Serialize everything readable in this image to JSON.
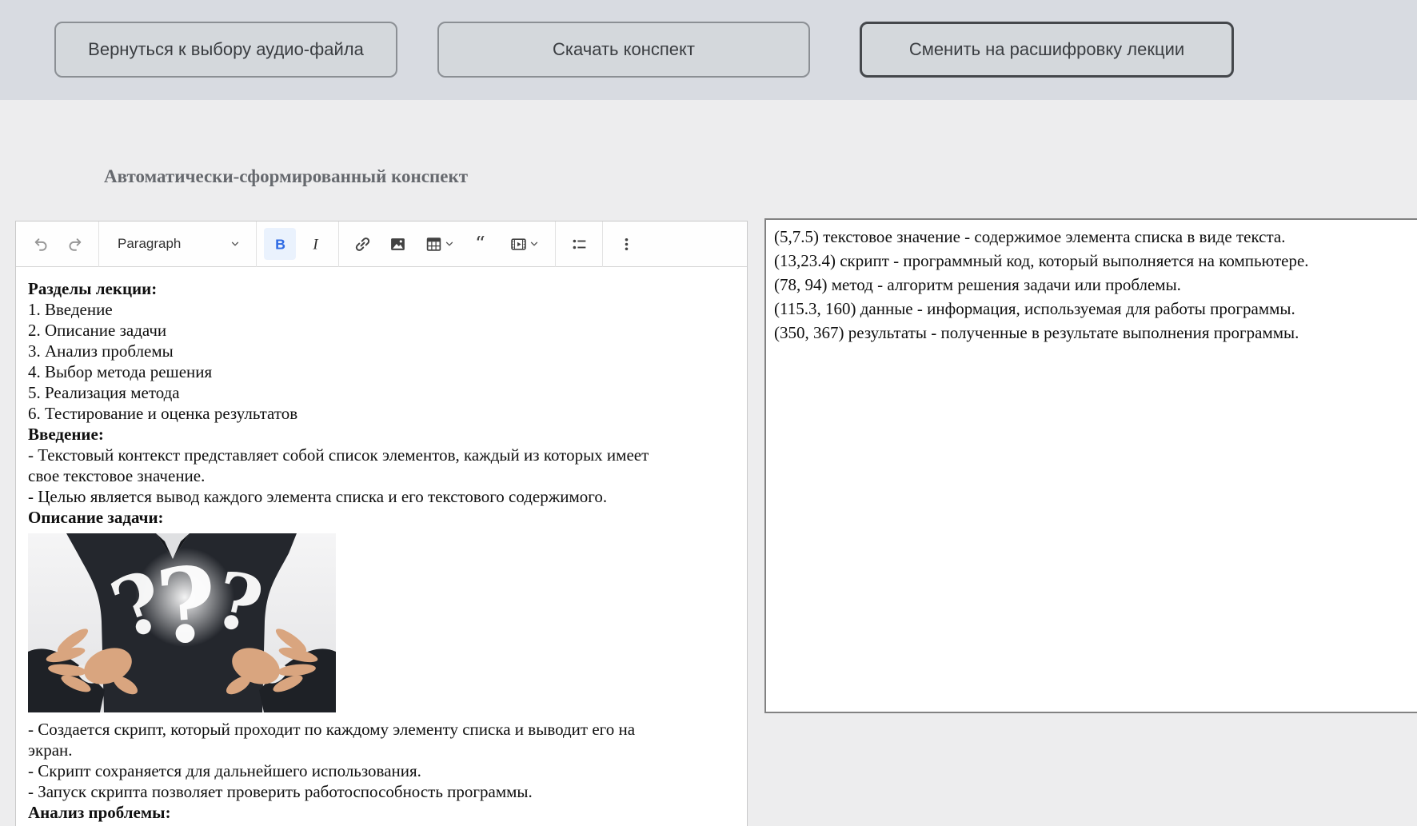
{
  "colors": {
    "topbar_bg": "#d8dbe1",
    "page_bg": "#ededee",
    "button_bg": "#d4d8dc",
    "button_border": "#8b8f94",
    "button_border_emphasized": "#44474b",
    "heading_color": "#66696e",
    "bold_active_bg": "#eaf2fd",
    "bold_icon_blue": "#2f6be4",
    "toolbar_icon_color": "#424242",
    "toolbar_disabled_icon_color": "#969696"
  },
  "topbar": {
    "buttons": [
      {
        "label": "Вернуться к выбору аудио-файла"
      },
      {
        "label": "Скачать конспект"
      },
      {
        "label": "Сменить на расшифровку лекции",
        "emphasized": true
      }
    ]
  },
  "heading": {
    "title": "Автоматически-сформированный конспект"
  },
  "editor": {
    "toolbar": {
      "paragraph_label": "Paragraph",
      "items": [
        {
          "type": "button",
          "name": "undo",
          "disabled": true
        },
        {
          "type": "button",
          "name": "redo",
          "disabled": true
        },
        {
          "type": "separator"
        },
        {
          "type": "dropdown",
          "name": "paragraph-style-dropdown",
          "label": "Paragraph"
        },
        {
          "type": "separator"
        },
        {
          "type": "button",
          "name": "bold",
          "active": true
        },
        {
          "type": "button",
          "name": "italic"
        },
        {
          "type": "separator"
        },
        {
          "type": "button",
          "name": "link"
        },
        {
          "type": "button",
          "name": "insert-image"
        },
        {
          "type": "button",
          "name": "insert-table",
          "chevron": true
        },
        {
          "type": "button",
          "name": "block-quote"
        },
        {
          "type": "button",
          "name": "insert-media",
          "chevron": true
        },
        {
          "type": "separator"
        },
        {
          "type": "button",
          "name": "bulleted-list"
        },
        {
          "type": "separator"
        },
        {
          "type": "button",
          "name": "more-options"
        }
      ]
    },
    "content": {
      "blocks": [
        {
          "bold": true,
          "text": "Разделы лекции:"
        },
        {
          "bold": false,
          "text": "1. Введение"
        },
        {
          "bold": false,
          "text": "2. Описание задачи"
        },
        {
          "bold": false,
          "text": "3. Анализ проблемы"
        },
        {
          "bold": false,
          "text": "4. Выбор метода решения"
        },
        {
          "bold": false,
          "text": "5. Реализация метода"
        },
        {
          "bold": false,
          "text": "6. Тестирование и оценка результатов"
        },
        {
          "bold": true,
          "text": "Введение:"
        },
        {
          "bold": false,
          "text": "- Текстовый контекст представляет собой список элементов, каждый из которых имеет"
        },
        {
          "bold": false,
          "text": "свое текстовое значение."
        },
        {
          "bold": false,
          "text": "- Целью является вывод каждого элемента списка и его текстового содержимого."
        },
        {
          "bold": true,
          "text": "Описание задачи:"
        },
        {
          "type": "image",
          "name": "question-marks-photo",
          "description": "man in dark suit with open palms presenting three chalk question marks"
        },
        {
          "bold": false,
          "text": "- Создается скрипт, который проходит по каждому элементу списка и выводит его на"
        },
        {
          "bold": false,
          "text": "экран."
        },
        {
          "bold": false,
          "text": "- Скрипт сохраняется для дальнейшего использования."
        },
        {
          "bold": false,
          "text": "- Запуск скрипта позволяет проверить работоспособность программы."
        },
        {
          "bold": true,
          "text": "Анализ проблемы:"
        }
      ]
    }
  },
  "timestamps": {
    "lines": [
      "(5,7.5) текстовое значение - содержимое элемента списка в виде текста.",
      "(13,23.4) скрипт - программный код, который выполняется на компьютере.",
      "(78, 94) метод - алгоритм решения задачи или проблемы.",
      "(115.3, 160) данные - информация, используемая для работы программы.",
      "(350, 367) результаты - полученные в результате выполнения программы."
    ]
  }
}
